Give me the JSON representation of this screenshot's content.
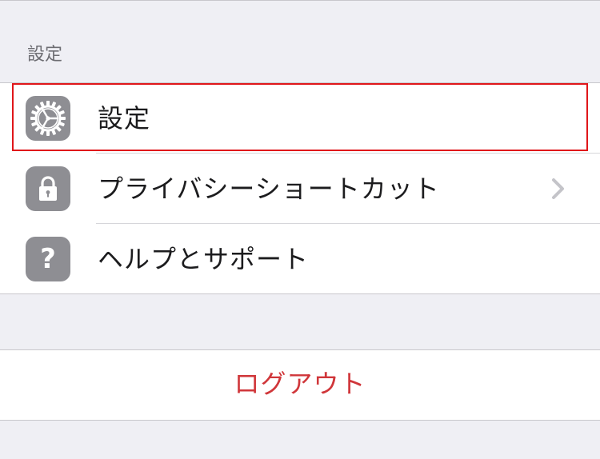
{
  "section": {
    "header": "設定"
  },
  "menu": {
    "items": [
      {
        "label": "設定",
        "icon": "gear-icon"
      },
      {
        "label": "プライバシーショートカット",
        "icon": "lock-icon",
        "chevron": "chevron-right-icon"
      },
      {
        "label": "ヘルプとサポート",
        "icon": "question-icon",
        "glyph": "?"
      }
    ]
  },
  "logout": {
    "label": "ログアウト"
  },
  "colors": {
    "background": "#efeff4",
    "icon_gray": "#8e8e93",
    "logout_red": "#d0363a",
    "highlight": "#e0161a"
  }
}
